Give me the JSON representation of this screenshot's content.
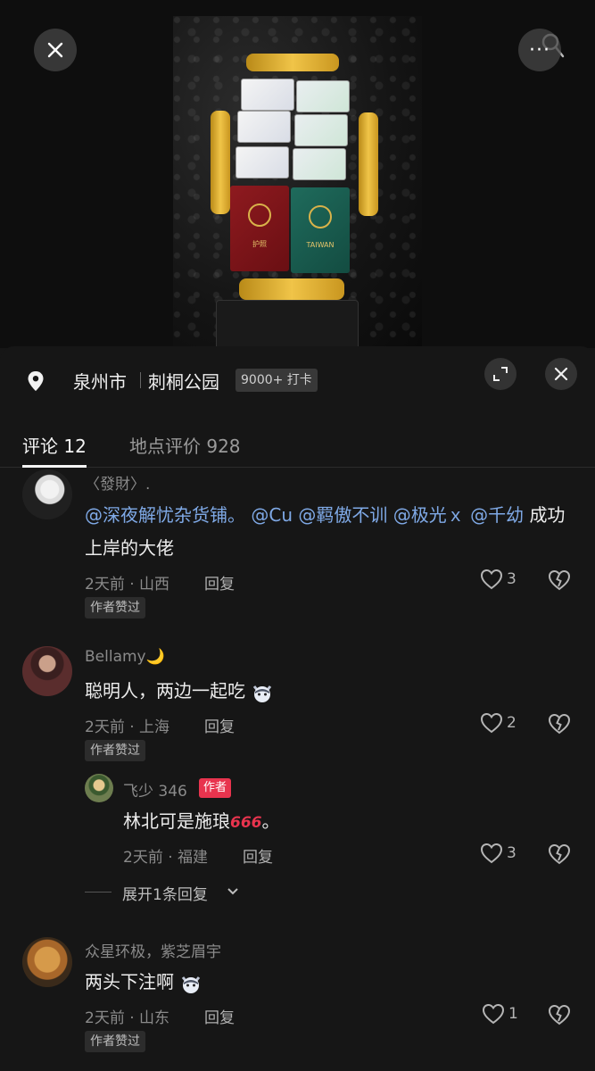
{
  "top": {
    "close_icon": "close-icon",
    "more_label": "···",
    "search_icon": "search-icon"
  },
  "location": {
    "city": "泉州市",
    "place": "刺桐公园",
    "checkins": "9000+ 打卡"
  },
  "tabs": [
    {
      "label": "评论 12",
      "active": true
    },
    {
      "label": "地点评价 928",
      "active": false
    }
  ],
  "comments": [
    {
      "user": "〈發財〉.",
      "text_parts": [
        "@深夜解忧杂货铺。",
        "@Cu",
        "@羁傲不训",
        "@极光ｘ",
        "@千幼",
        "成功上岸的大佬"
      ],
      "time": "2天前 · 山西",
      "reply": "回复",
      "badge": "作者赞过",
      "likes": "3"
    },
    {
      "user": "Bellamy🌙",
      "text": "聪明人，两边一起吃",
      "time": "2天前 · 上海",
      "reply": "回复",
      "badge": "作者赞过",
      "likes": "2"
    },
    {
      "user": "飞少 346",
      "author_tag": "作者",
      "text": "林北可是施琅",
      "text_suffix": "666",
      "text_end": "。",
      "time": "2天前 · 福建",
      "reply": "回复",
      "likes": "3"
    },
    {
      "user": "众星环极，紫芝眉宇",
      "text": "两头下注啊",
      "time": "2天前 · 山东",
      "reply": "回复",
      "badge": "作者赞过",
      "likes": "1"
    }
  ],
  "expand_replies": "展开1条回复",
  "colors": {
    "background": "#161616",
    "mention": "#7fa9e6",
    "author_badge": "#e8344e"
  }
}
